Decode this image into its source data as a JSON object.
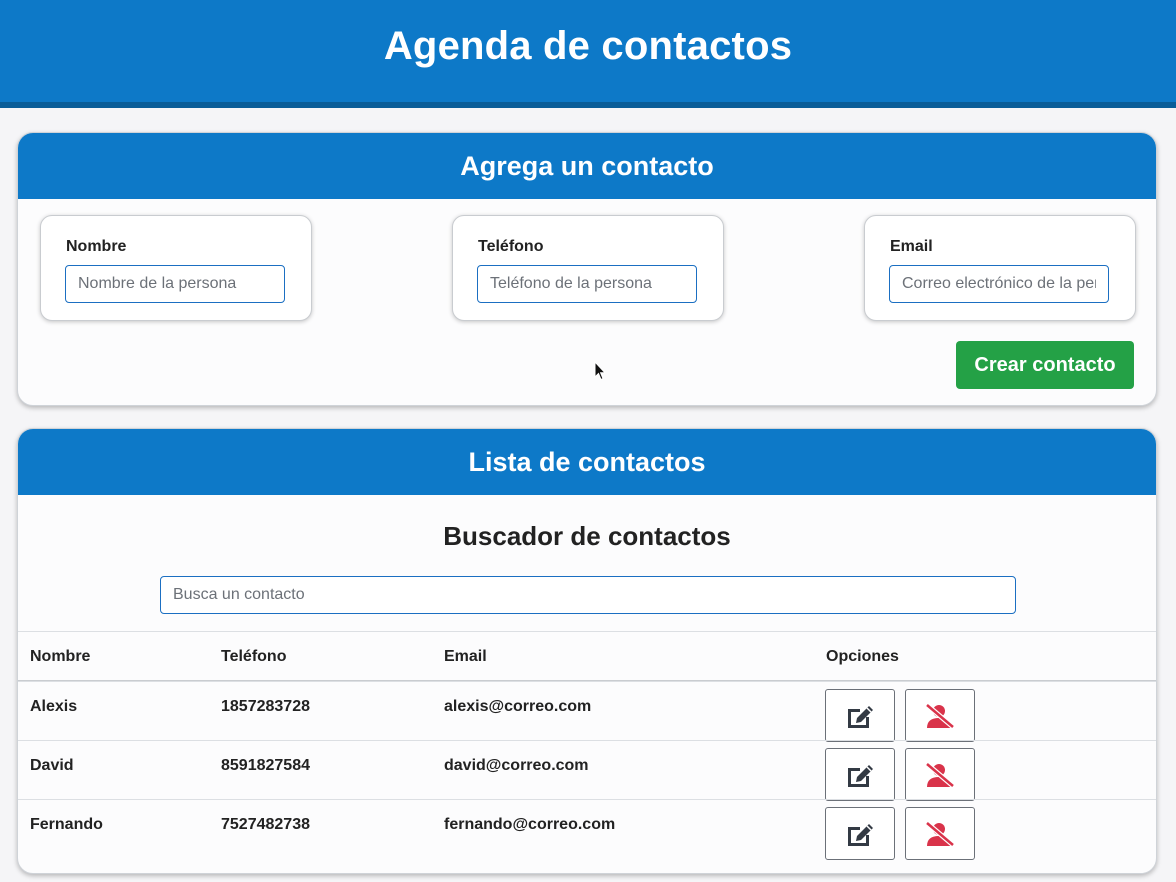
{
  "header": {
    "title": "Agenda de contactos"
  },
  "add_contact": {
    "title": "Agrega un contacto",
    "fields": [
      {
        "label": "Nombre",
        "placeholder": "Nombre de la persona",
        "value": ""
      },
      {
        "label": "Teléfono",
        "placeholder": "Teléfono de la persona",
        "value": ""
      },
      {
        "label": "Email",
        "placeholder": "Correo electrónico de la persona",
        "value": ""
      }
    ],
    "submit_label": "Crear contacto"
  },
  "contact_list": {
    "title": "Lista de contactos",
    "search": {
      "title": "Buscador de contactos",
      "placeholder": "Busca un contacto",
      "value": ""
    },
    "columns": [
      "Nombre",
      "Teléfono",
      "Email",
      "Opciones"
    ],
    "rows": [
      {
        "name": "Alexis",
        "phone": "1857283728",
        "email": "alexis@correo.com"
      },
      {
        "name": "David",
        "phone": "8591827584",
        "email": "david@correo.com"
      },
      {
        "name": "Fernando",
        "phone": "7527482738",
        "email": "fernando@correo.com"
      }
    ],
    "row_actions": {
      "edit_icon": "edit-icon",
      "delete_icon": "user-slash-icon"
    }
  },
  "colors": {
    "primary": "#0d79c8",
    "success": "#24a146",
    "danger": "#d9334a",
    "icon_dark": "#333a44"
  }
}
